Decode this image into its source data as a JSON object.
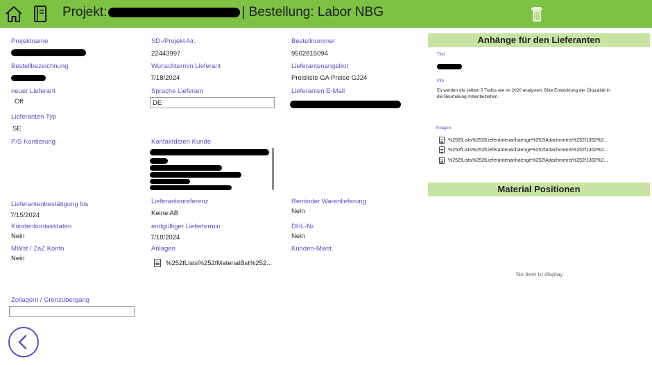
{
  "header": {
    "title_prefix": "Projekt:",
    "title_suffix": "| Bestellung: Labor NBG"
  },
  "fields": {
    "projektname": {
      "label": "Projektname"
    },
    "sd_nr": {
      "label": "SD-/Projekt-Nr.",
      "value": "22443997"
    },
    "bestellnummer": {
      "label": "Bestellnummer",
      "value": "9502815094"
    },
    "bestellbezeichnung": {
      "label": "Bestellbezeichnung"
    },
    "wunschtermin": {
      "label": "Wunschtermin Lieferant",
      "value": "7/18/2024"
    },
    "lieferantenangebot": {
      "label": "Lieferantenangebot",
      "value": "Preisliste GA Preise GJ24"
    },
    "neuer_lieferant": {
      "label": "neuer Lieferant",
      "value": "Off"
    },
    "sprache": {
      "label": "Sprache Lieferant",
      "value": "DE"
    },
    "lieferanten_email": {
      "label": "Lieferanten E-Mail"
    },
    "lieferanten_typ": {
      "label": "Lieferanten Typ",
      "value": "SE"
    },
    "ps_kontierung": {
      "label": "P/S Kontierung"
    },
    "kontaktdaten": {
      "label": "Kontaktdaten Kunde"
    },
    "bestaetigung": {
      "label": "Lieferantenbestätigung bis",
      "value": "7/15/2024"
    },
    "referenz": {
      "label": "Lieferantenreferenz",
      "value": "Keine AB"
    },
    "reminder": {
      "label": "Reminder Warenlieferung",
      "value": "Nein"
    },
    "kundenkontakt": {
      "label": "Kundenkontaktdaten",
      "value": "Nein"
    },
    "liefertermin": {
      "label": "endgültiger Liefertermin",
      "value": "7/18/2024"
    },
    "dhl": {
      "label": "DHL-Nr.",
      "value": "Nein"
    },
    "mwst": {
      "label": "MWst / ZaZ Konto",
      "value": "Nein"
    },
    "anlagen": {
      "label": "Anlagen",
      "file": "%252fLists%252fMaterialBst%252..."
    },
    "kunden_mwst": {
      "label": "Kunden-Mwst."
    },
    "zollagent": {
      "label": "Zollagent / Grenzübergang",
      "value": ""
    }
  },
  "attachments_panel": {
    "title": "Anhänge für den Lieferanten",
    "titel_label": "Titel",
    "info_label": "Info",
    "info_text": "Es werden die selben 5 Trafos wie im 2020 analysiert. Bitte Entwicklung der Ölqualität in die Beurteilung miteinbeziehen.",
    "anlagen_label": "Anlagen",
    "files": [
      "%252fLists%252fLieferantenanhaenge%252fAttachments%252f1302%2...",
      "%252fLists%252fLieferantenanhaenge%252fAttachments%252f1302%2...",
      "%252fLists%252fLieferantenanhaenge%252fAttachments%252f1302%2..."
    ]
  },
  "material_panel": {
    "title": "Material Positionen",
    "empty_text": "No item to display"
  }
}
